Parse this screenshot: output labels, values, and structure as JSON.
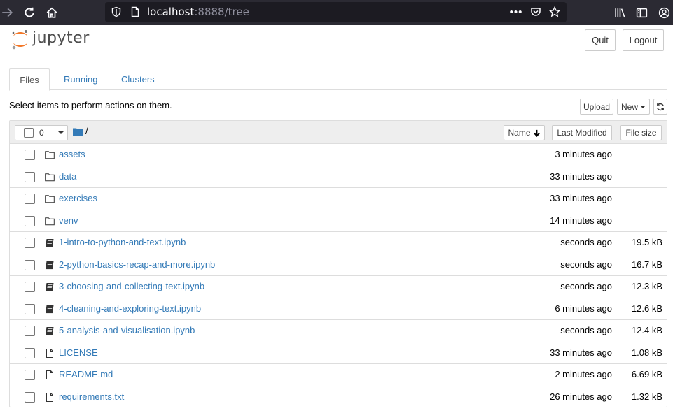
{
  "browser": {
    "url_host": "localhost",
    "url_rest": ":8888/tree",
    "more_label": "•••"
  },
  "header": {
    "logo_text": "jupyter",
    "quit_label": "Quit",
    "logout_label": "Logout"
  },
  "tabs": [
    {
      "label": "Files",
      "active": true
    },
    {
      "label": "Running",
      "active": false
    },
    {
      "label": "Clusters",
      "active": false
    }
  ],
  "toolbar": {
    "instructions": "Select items to perform actions on them.",
    "upload_label": "Upload",
    "new_label": "New"
  },
  "list_header": {
    "selected_count": "0",
    "breadcrumb": "/",
    "sort_name_label": "Name",
    "sort_modified_label": "Last Modified",
    "sort_size_label": "File size"
  },
  "items": [
    {
      "type": "folder",
      "name": "assets",
      "modified": "3 minutes ago",
      "size": ""
    },
    {
      "type": "folder",
      "name": "data",
      "modified": "33 minutes ago",
      "size": ""
    },
    {
      "type": "folder",
      "name": "exercises",
      "modified": "33 minutes ago",
      "size": ""
    },
    {
      "type": "folder",
      "name": "venv",
      "modified": "14 minutes ago",
      "size": ""
    },
    {
      "type": "notebook",
      "name": "1-intro-to-python-and-text.ipynb",
      "modified": "seconds ago",
      "size": "19.5 kB"
    },
    {
      "type": "notebook",
      "name": "2-python-basics-recap-and-more.ipynb",
      "modified": "seconds ago",
      "size": "16.7 kB"
    },
    {
      "type": "notebook",
      "name": "3-choosing-and-collecting-text.ipynb",
      "modified": "seconds ago",
      "size": "12.3 kB"
    },
    {
      "type": "notebook",
      "name": "4-cleaning-and-exploring-text.ipynb",
      "modified": "6 minutes ago",
      "size": "12.6 kB"
    },
    {
      "type": "notebook",
      "name": "5-analysis-and-visualisation.ipynb",
      "modified": "seconds ago",
      "size": "12.4 kB"
    },
    {
      "type": "file",
      "name": "LICENSE",
      "modified": "33 minutes ago",
      "size": "1.08 kB"
    },
    {
      "type": "file",
      "name": "README.md",
      "modified": "2 minutes ago",
      "size": "6.69 kB"
    },
    {
      "type": "file",
      "name": "requirements.txt",
      "modified": "26 minutes ago",
      "size": "1.32 kB"
    }
  ],
  "colors": {
    "link": "#337ab7",
    "logo_orange": "#f37626",
    "browser_bar": "#2b2a33"
  }
}
